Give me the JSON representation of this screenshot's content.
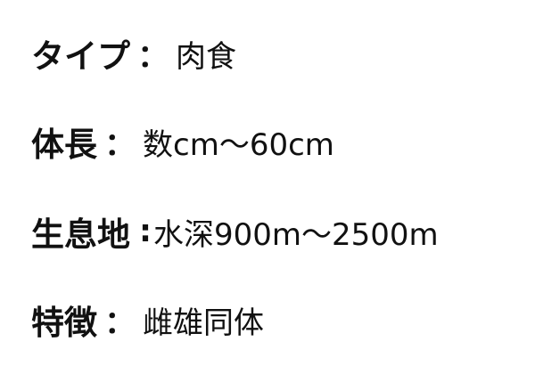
{
  "rows": [
    {
      "label": "タイプ",
      "separator": "：",
      "value": "肉食"
    },
    {
      "label": "体長",
      "separator": "：",
      "value": "数cm～60cm"
    },
    {
      "label": "生息地",
      "separator": ":",
      "value": "水深900m～2500m"
    },
    {
      "label": "特徴",
      "separator": "：",
      "value": "雌雄同体"
    }
  ]
}
